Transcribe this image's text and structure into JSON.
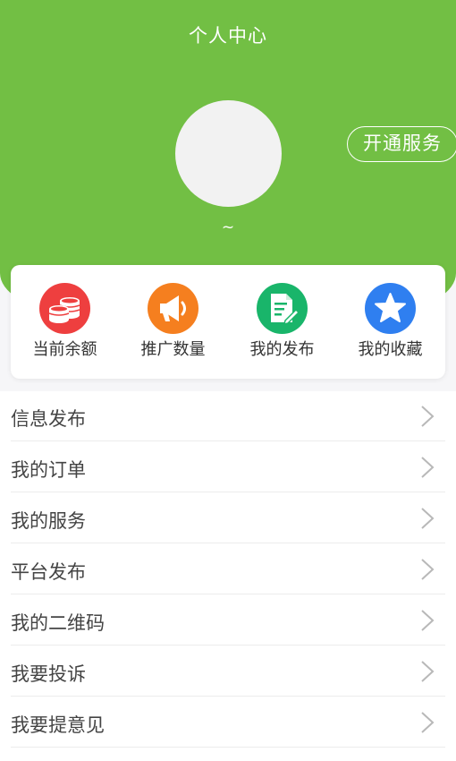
{
  "header": {
    "title": "个人中心",
    "service_button": "开通服务",
    "username": "~",
    "accent_color": "#72bf44"
  },
  "quick_actions": [
    {
      "label": "当前余额",
      "icon": "coins-icon",
      "color": "#ee3f3f"
    },
    {
      "label": "推广数量",
      "icon": "megaphone-icon",
      "color": "#f57f1f"
    },
    {
      "label": "我的发布",
      "icon": "document-edit-icon",
      "color": "#19b56a"
    },
    {
      "label": "我的收藏",
      "icon": "star-icon",
      "color": "#2f7ff0"
    }
  ],
  "menu": {
    "items": [
      {
        "label": "信息发布"
      },
      {
        "label": "我的订单"
      },
      {
        "label": "我的服务"
      },
      {
        "label": "平台发布"
      },
      {
        "label": "我的二维码"
      },
      {
        "label": "我要投诉"
      },
      {
        "label": "我要提意见"
      }
    ],
    "chevron_icon": "chevron-right-icon"
  }
}
